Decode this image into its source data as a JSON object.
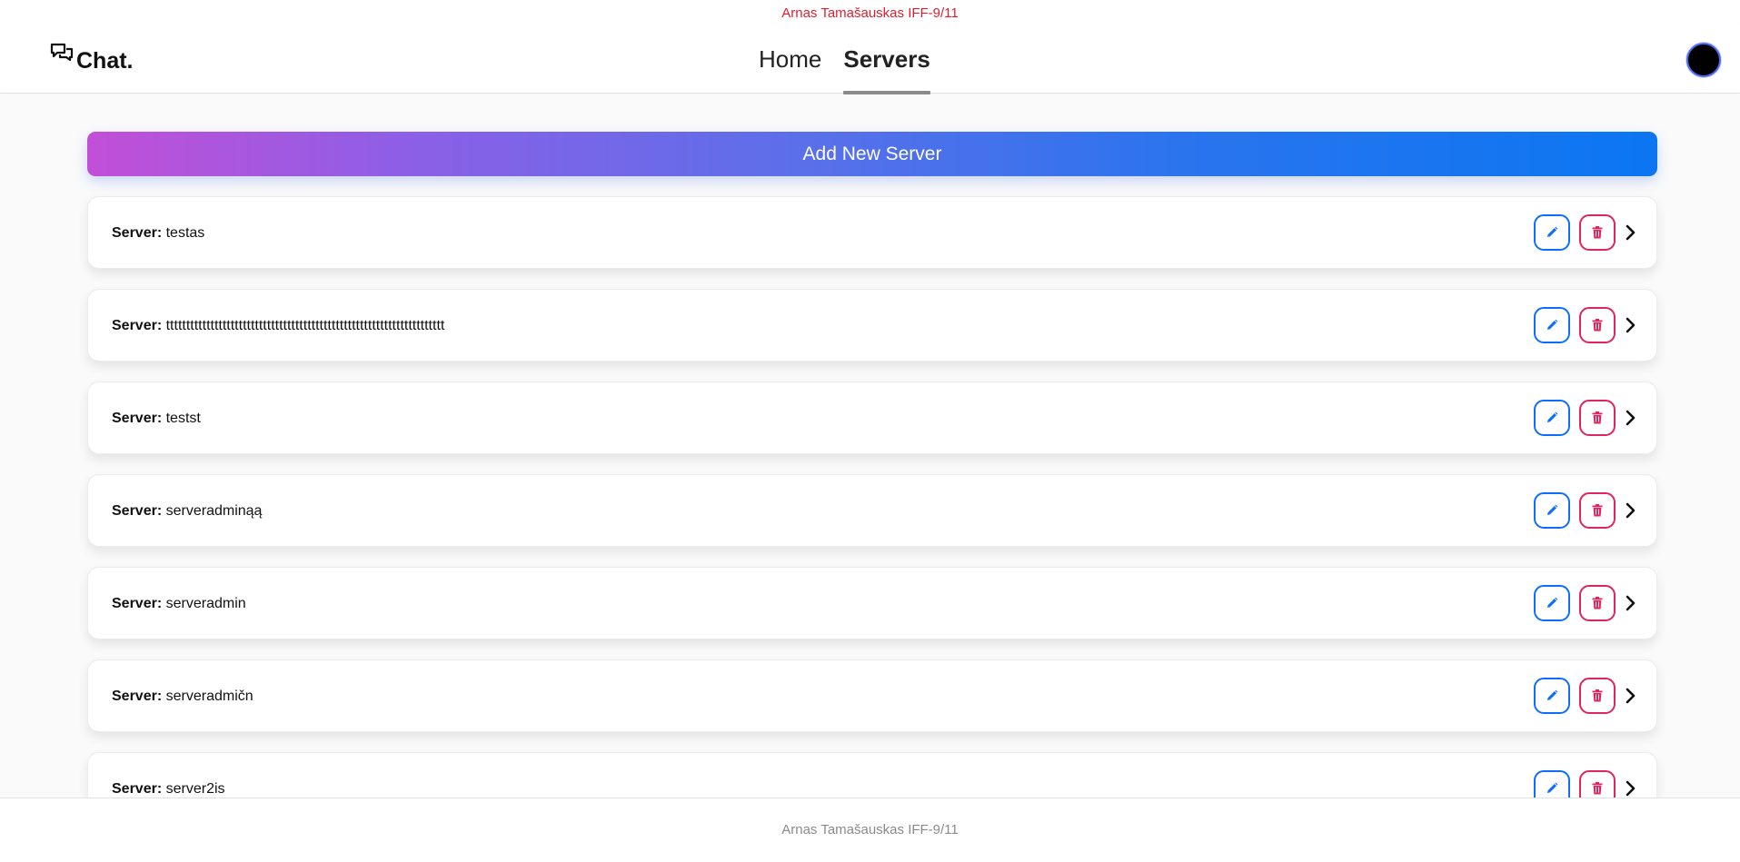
{
  "top_banner": "Arnas Tamašauskas IFF-9/11",
  "brand": {
    "name": "Chat.",
    "icon": "chat-bubbles-icon"
  },
  "nav": {
    "home": "Home",
    "servers": "Servers",
    "active": "servers"
  },
  "add_button_label": "Add New Server",
  "server_label": "Server:",
  "servers": [
    {
      "name": "testas"
    },
    {
      "name": "ttttttttttttttttttttttttttttttttttttttttttttttttttttttttttttttttttttt"
    },
    {
      "name": "testst"
    },
    {
      "name": "serveradminąą"
    },
    {
      "name": "serveradmin"
    },
    {
      "name": "serveradmičn"
    },
    {
      "name": "server2is"
    }
  ],
  "row_actions": {
    "edit_icon": "pencil-icon",
    "delete_icon": "trash-icon",
    "open_icon": "chevron-right-icon"
  },
  "footer": "Arnas Tamašauskas IFF-9/11",
  "colors": {
    "banner_text": "#e01e2e",
    "edit_accent": "#0d6efd",
    "delete_accent": "#e0245e",
    "gradient_start": "#c24fd7",
    "gradient_end": "#0b76f2"
  }
}
